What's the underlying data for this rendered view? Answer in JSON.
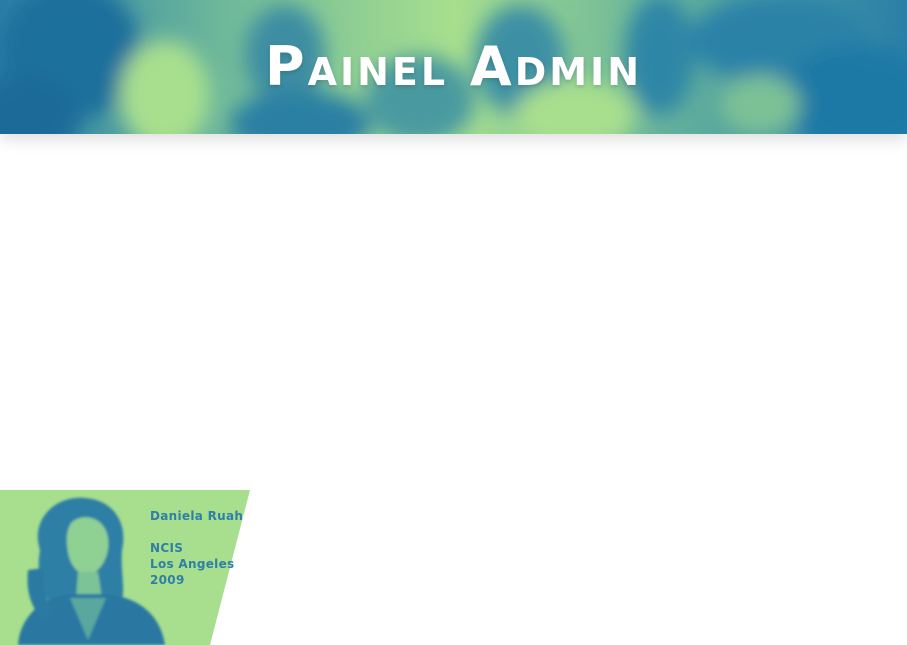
{
  "header": {
    "title": "Painel Admin"
  },
  "cast_card": {
    "actor_name": "Daniela Ruah",
    "show_name": "NCIS",
    "show_subtitle": "Los Angeles",
    "year": "2009"
  },
  "colors": {
    "duotone_green": "#a8df8e",
    "duotone_blue": "#1f79a5",
    "title_text": "#ffffff",
    "card_text": "#2f7fa6"
  }
}
